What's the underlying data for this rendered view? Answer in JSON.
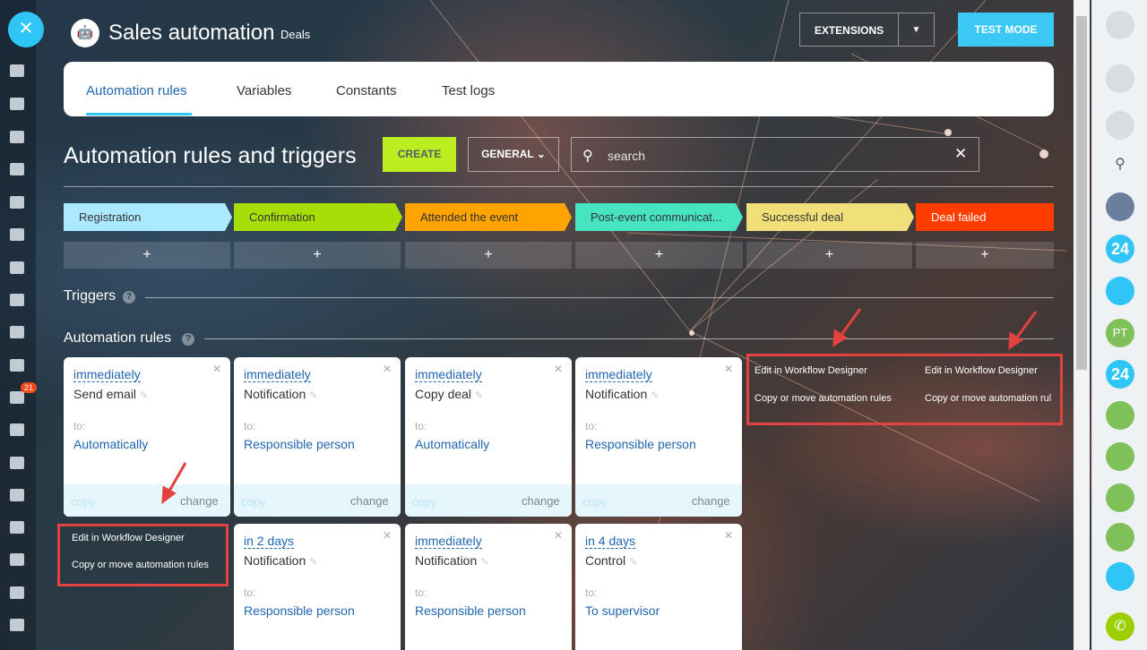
{
  "header": {
    "title": "Sales automation",
    "subtitle": "Deals",
    "extensions_label": "EXTENSIONS",
    "test_mode_label": "TEST MODE"
  },
  "tabs": [
    {
      "label": "Automation rules",
      "active": true
    },
    {
      "label": "Variables",
      "active": false
    },
    {
      "label": "Constants",
      "active": false
    },
    {
      "label": "Test logs",
      "active": false
    }
  ],
  "toolbar": {
    "page_title": "Automation rules and triggers",
    "create_label": "CREATE",
    "general_label": "GENERAL",
    "search_placeholder": "search"
  },
  "stages": [
    {
      "label": "Registration",
      "color": "#aae9fe"
    },
    {
      "label": "Confirmation",
      "color": "#a8de08"
    },
    {
      "label": "Attended the event",
      "color": "#ffa300"
    },
    {
      "label": "Post-event communicat...",
      "color": "#47e4c2"
    },
    {
      "label": "Successful deal",
      "color": "#f1e07a"
    },
    {
      "label": "Deal failed",
      "color": "#ff3d00"
    }
  ],
  "add_label": "+",
  "sections": {
    "triggers": "Triggers",
    "rules": "Automation rules"
  },
  "cards": [
    {
      "delay": "immediately",
      "name": "Send email",
      "to": "to:",
      "target": "Automatically",
      "copy": "copy",
      "change": "change"
    },
    {
      "delay": "immediately",
      "name": "Notification",
      "to": "to:",
      "target": "Responsible person",
      "copy": "copy",
      "change": "change"
    },
    {
      "delay": "immediately",
      "name": "Copy deal",
      "to": "to:",
      "target": "Automatically",
      "copy": "copy",
      "change": "change"
    },
    {
      "delay": "immediately",
      "name": "Notification",
      "to": "to:",
      "target": "Responsible person",
      "copy": "copy",
      "change": "change"
    },
    {
      "delay": "in 2 days",
      "name": "Notification",
      "to": "to:",
      "target": "Responsible person"
    },
    {
      "delay": "immediately",
      "name": "Notification",
      "to": "to:",
      "target": "Responsible person"
    },
    {
      "delay": "in 4 days",
      "name": "Control",
      "to": "to:",
      "target": "To supervisor"
    }
  ],
  "menus": [
    {
      "edit": "Edit in Workflow Designer",
      "copy": "Copy or move automation rules"
    },
    {
      "edit": "Edit in Workflow Designer",
      "copy": "Copy or move automation rules"
    },
    {
      "edit": "Edit in Workflow Designer",
      "copy": "Copy or move automation rul"
    }
  ],
  "right_rail": {
    "badge_24": "24",
    "initials": "PT"
  },
  "left_rail": {
    "badge_count": "21"
  },
  "colors": {
    "accent": "#2fc6f6",
    "create": "#bbed21",
    "link": "#2067b0",
    "annotation": "#e44141"
  }
}
